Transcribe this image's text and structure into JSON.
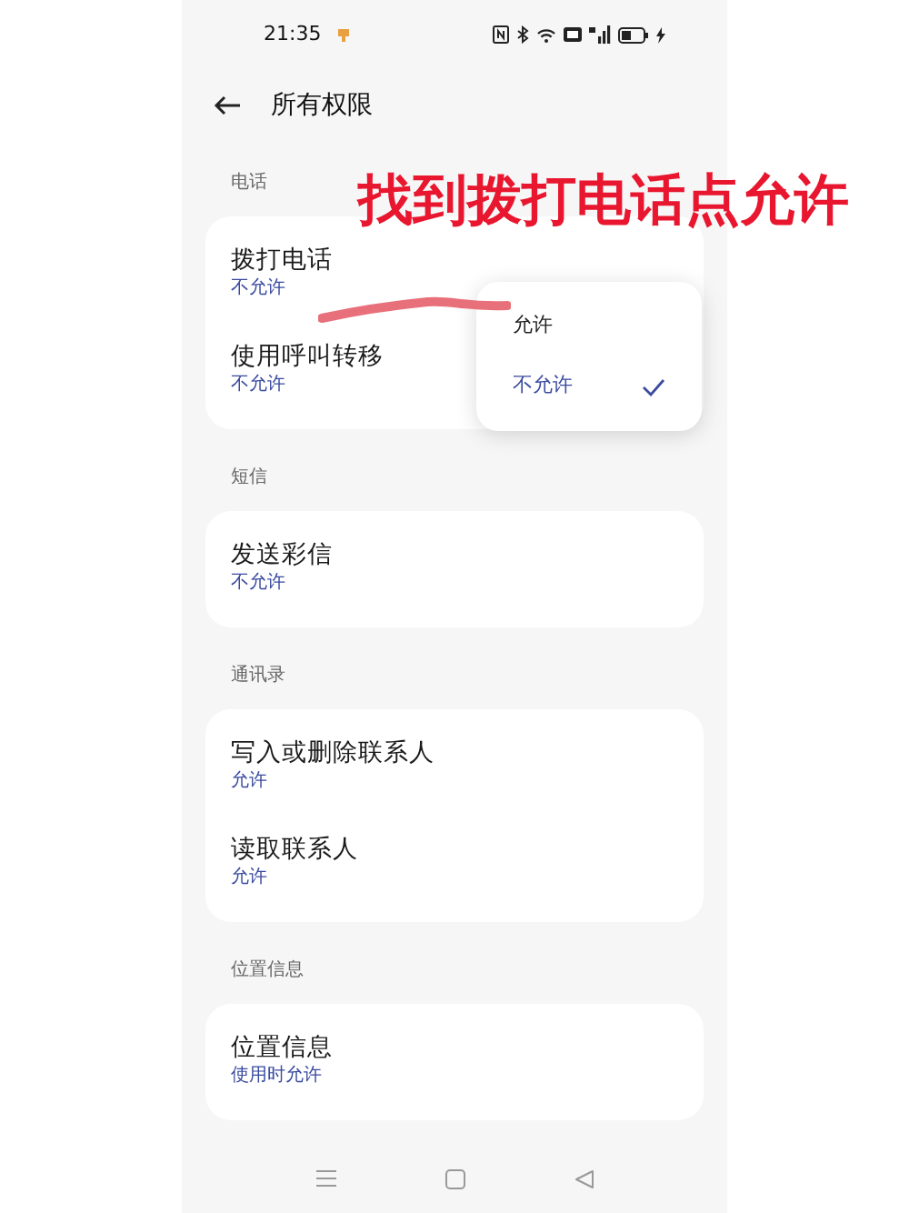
{
  "status_bar": {
    "time": "21:35"
  },
  "header": {
    "title": "所有权限"
  },
  "sections": [
    {
      "title": "电话",
      "items": [
        {
          "name": "拨打电话",
          "value": "不允许"
        },
        {
          "name": "使用呼叫转移",
          "value": "不允许"
        }
      ]
    },
    {
      "title": "短信",
      "items": [
        {
          "name": "发送彩信",
          "value": "不允许"
        }
      ]
    },
    {
      "title": "通讯录",
      "items": [
        {
          "name": "写入或删除联系人",
          "value": "允许"
        },
        {
          "name": "读取联系人",
          "value": "允许"
        }
      ]
    },
    {
      "title": "位置信息",
      "items": [
        {
          "name": "位置信息",
          "value": "使用时允许"
        }
      ]
    }
  ],
  "popup_menu": {
    "options": [
      {
        "label": "允许",
        "selected": false
      },
      {
        "label": "不允许",
        "selected": true
      }
    ]
  },
  "annotation": {
    "text": "找到拨打电话点允许"
  }
}
